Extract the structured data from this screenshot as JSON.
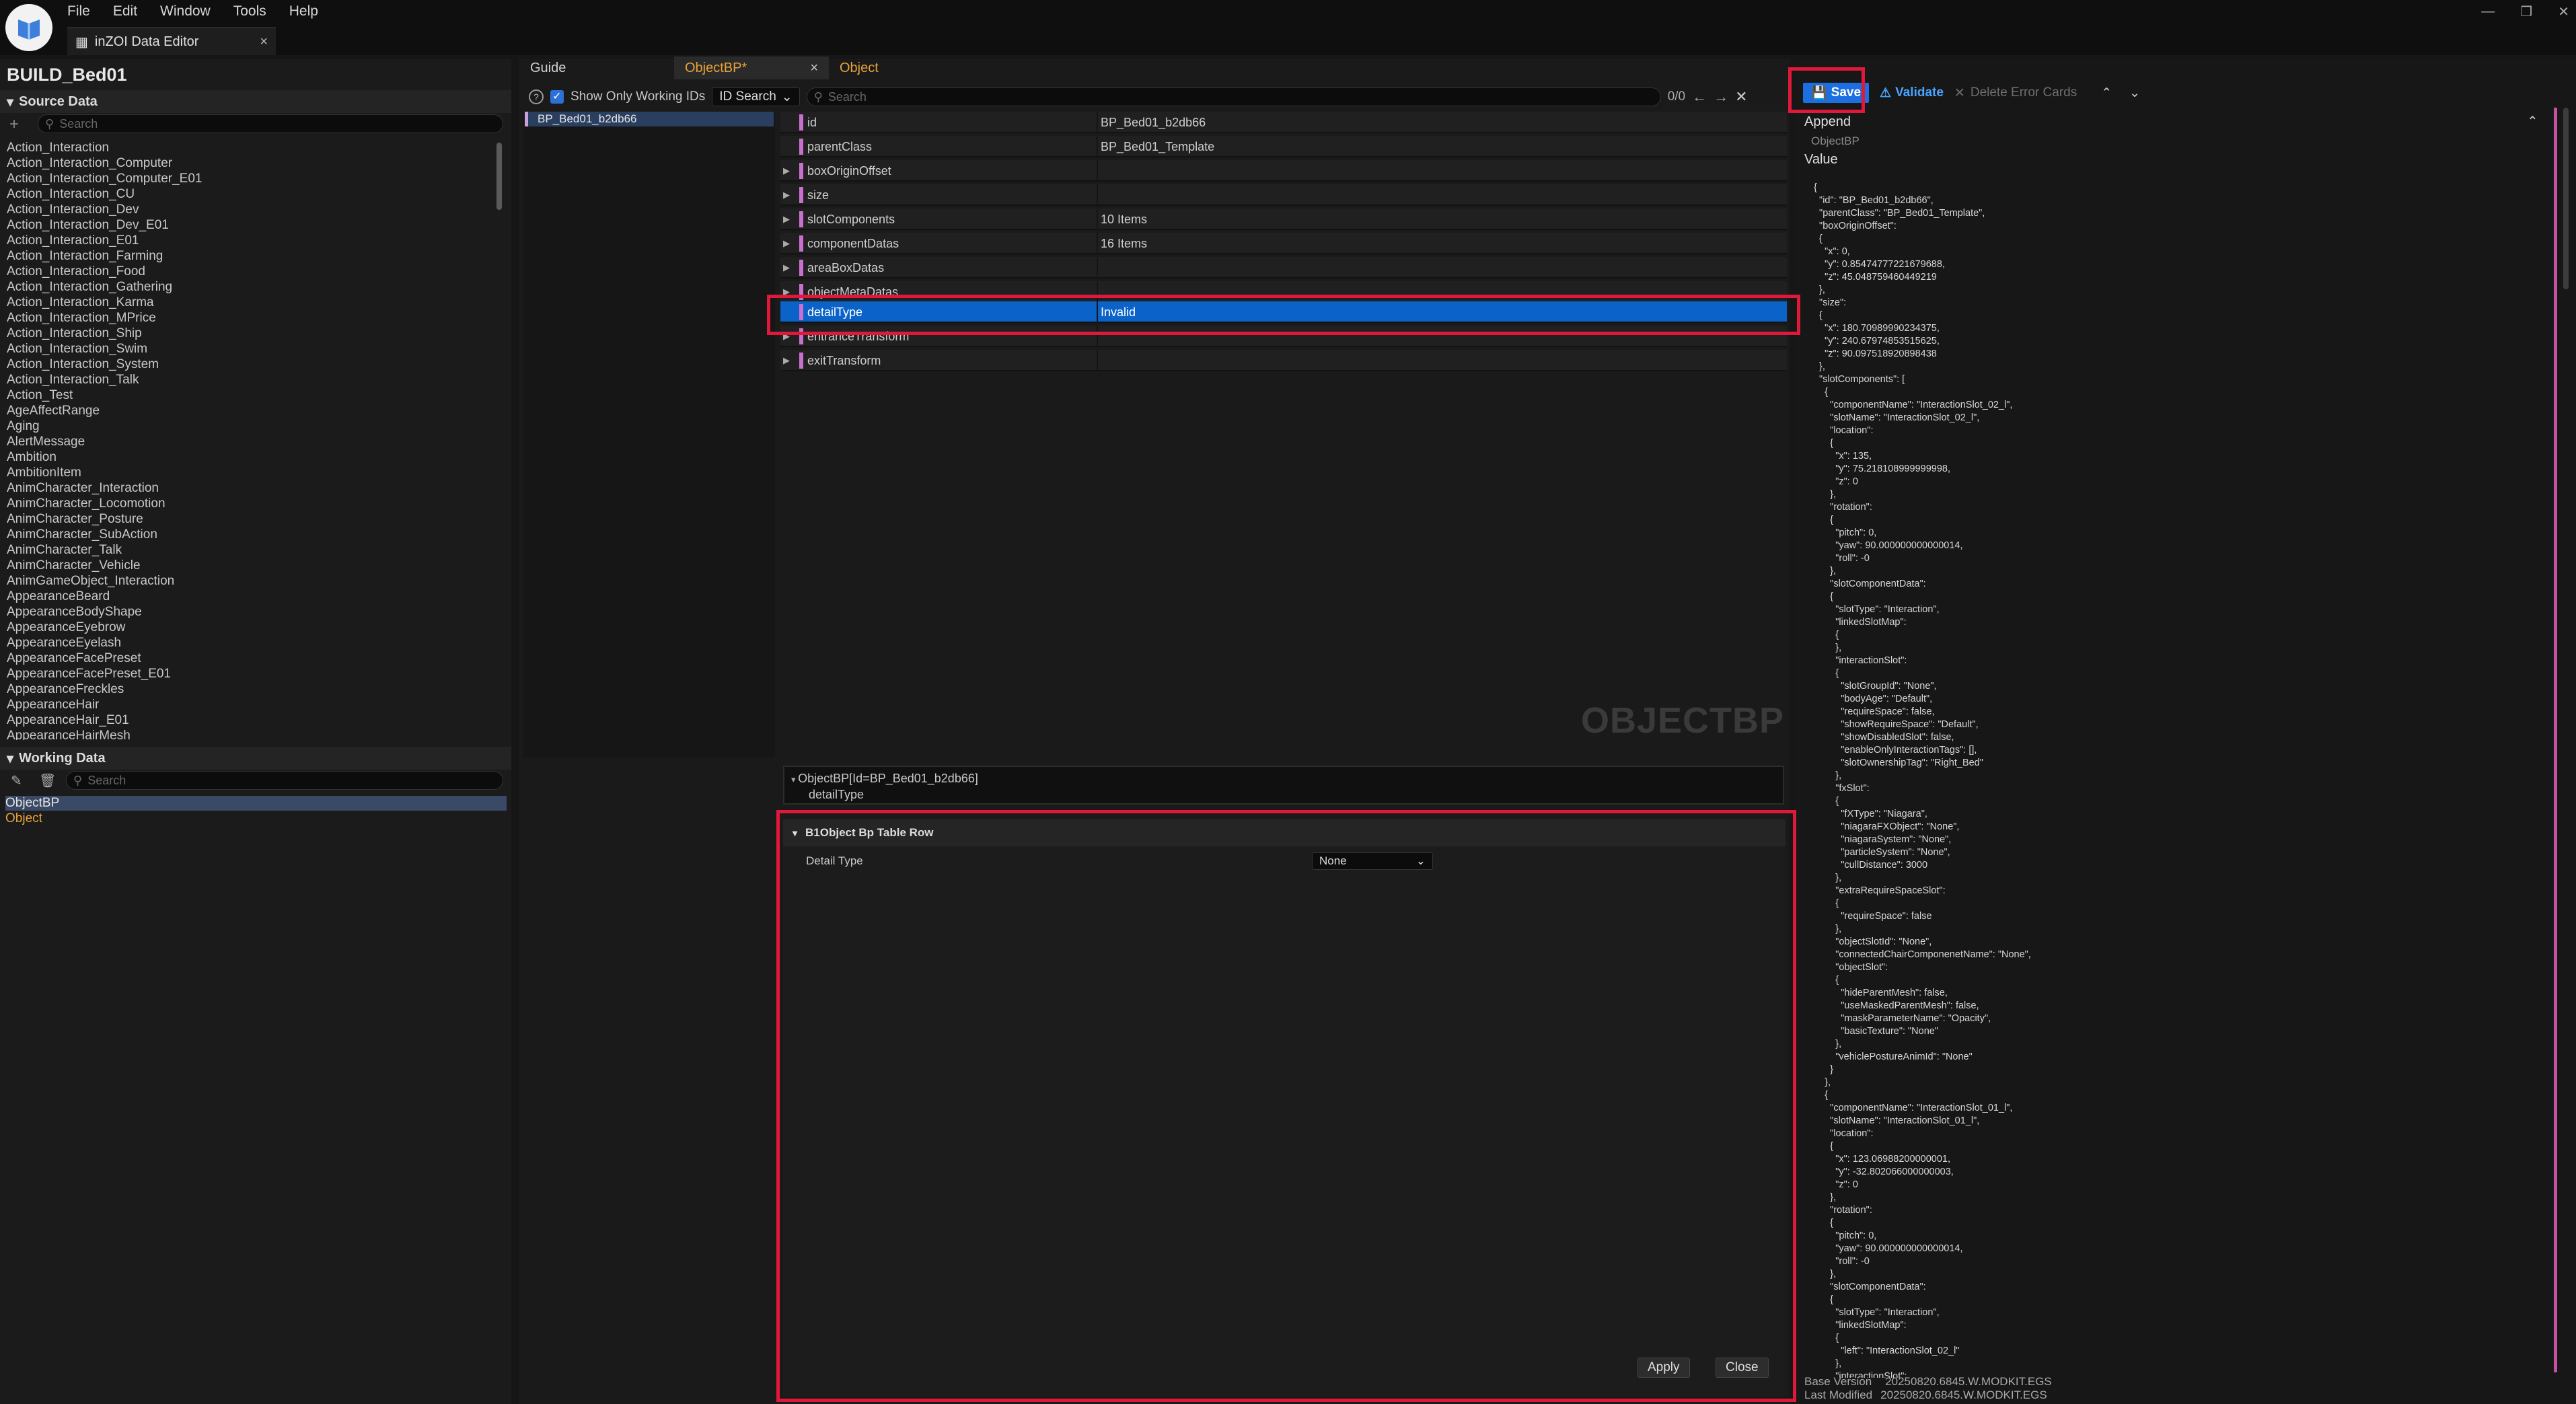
{
  "menu": {
    "file": "File",
    "edit": "Edit",
    "window": "Window",
    "tools": "Tools",
    "help": "Help"
  },
  "doc_tab": {
    "title": "inZOI Data Editor",
    "close": "×"
  },
  "left": {
    "title": "BUILD_Bed01",
    "source_header": "Source Data",
    "search_placeholder": "Search",
    "source_items": [
      "Action_Interaction",
      "Action_Interaction_Computer",
      "Action_Interaction_Computer_E01",
      "Action_Interaction_CU",
      "Action_Interaction_Dev",
      "Action_Interaction_Dev_E01",
      "Action_Interaction_E01",
      "Action_Interaction_Farming",
      "Action_Interaction_Food",
      "Action_Interaction_Gathering",
      "Action_Interaction_Karma",
      "Action_Interaction_MPrice",
      "Action_Interaction_Ship",
      "Action_Interaction_Swim",
      "Action_Interaction_System",
      "Action_Interaction_Talk",
      "Action_Test",
      "AgeAffectRange",
      "Aging",
      "AlertMessage",
      "Ambition",
      "AmbitionItem",
      "AnimCharacter_Interaction",
      "AnimCharacter_Locomotion",
      "AnimCharacter_Posture",
      "AnimCharacter_SubAction",
      "AnimCharacter_Talk",
      "AnimCharacter_Vehicle",
      "AnimGameObject_Interaction",
      "AppearanceBeard",
      "AppearanceBodyShape",
      "AppearanceEyebrow",
      "AppearanceEyelash",
      "AppearanceFacePreset",
      "AppearanceFacePreset_E01",
      "AppearanceFreckles",
      "AppearanceHair",
      "AppearanceHair_E01",
      "AppearanceHairMesh"
    ],
    "working_header": "Working Data",
    "working_items": [
      "ObjectBP",
      "Object"
    ]
  },
  "middle": {
    "tabs": [
      "Guide",
      "ObjectBP*",
      "Object"
    ],
    "tab_close": "×",
    "show_only_label": "Show Only Working IDs",
    "id_search": "ID Search",
    "search_placeholder": "Search",
    "match_count": "0/0",
    "selected_id": "BP_Bed01_b2db66",
    "properties": [
      {
        "key": "id",
        "value": "BP_Bed01_b2db66"
      },
      {
        "key": "parentClass",
        "value": "BP_Bed01_Template"
      },
      {
        "key": "boxOriginOffset",
        "value": ""
      },
      {
        "key": "size",
        "value": ""
      },
      {
        "key": "slotComponents",
        "value": "10 Items"
      },
      {
        "key": "componentDatas",
        "value": "16 Items"
      },
      {
        "key": "areaBoxDatas",
        "value": ""
      },
      {
        "key": "objectMetaDatas",
        "value": ""
      },
      {
        "key": "detailType",
        "value": "Invalid"
      },
      {
        "key": "entranceTransform",
        "value": ""
      },
      {
        "key": "exitTransform",
        "value": ""
      }
    ],
    "watermark": "OBJECTBP",
    "path_line1": "ObjectBP[Id=BP_Bed01_b2db66]",
    "path_line2": "detailType",
    "detail_header": "B1Object Bp Table Row",
    "detail_label": "Detail Type",
    "detail_value": "None",
    "apply": "Apply",
    "close": "Close"
  },
  "right": {
    "save": "Save",
    "validate": "Validate",
    "delete_errors": "Delete Error Cards",
    "append": "Append",
    "object_label": "ObjectBP",
    "value_label": "Value",
    "json_text": "{\n  \"id\": \"BP_Bed01_b2db66\",\n  \"parentClass\": \"BP_Bed01_Template\",\n  \"boxOriginOffset\":\n  {\n    \"x\": 0,\n    \"y\": 0.85474777221679688,\n    \"z\": 45.048759460449219\n  },\n  \"size\":\n  {\n    \"x\": 180.70989990234375,\n    \"y\": 240.67974853515625,\n    \"z\": 90.097518920898438\n  },\n  \"slotComponents\": [\n    {\n      \"componentName\": \"InteractionSlot_02_l\",\n      \"slotName\": \"InteractionSlot_02_l\",\n      \"location\":\n      {\n        \"x\": 135,\n        \"y\": 75.218108999999998,\n        \"z\": 0\n      },\n      \"rotation\":\n      {\n        \"pitch\": 0,\n        \"yaw\": 90.000000000000014,\n        \"roll\": -0\n      },\n      \"slotComponentData\":\n      {\n        \"slotType\": \"Interaction\",\n        \"linkedSlotMap\":\n        {\n        },\n        \"interactionSlot\":\n        {\n          \"slotGroupId\": \"None\",\n          \"bodyAge\": \"Default\",\n          \"requireSpace\": false,\n          \"showRequireSpace\": \"Default\",\n          \"showDisabledSlot\": false,\n          \"enableOnlyInteractionTags\": [],\n          \"slotOwnershipTag\": \"Right_Bed\"\n        },\n        \"fxSlot\":\n        {\n          \"fXType\": \"Niagara\",\n          \"niagaraFXObject\": \"None\",\n          \"niagaraSystem\": \"None\",\n          \"particleSystem\": \"None\",\n          \"cullDistance\": 3000\n        },\n        \"extraRequireSpaceSlot\":\n        {\n          \"requireSpace\": false\n        },\n        \"objectSlotId\": \"None\",\n        \"connectedChairComponenetName\": \"None\",\n        \"objectSlot\":\n        {\n          \"hideParentMesh\": false,\n          \"useMaskedParentMesh\": false,\n          \"maskParameterName\": \"Opacity\",\n          \"basicTexture\": \"None\"\n        },\n        \"vehiclePostureAnimId\": \"None\"\n      }\n    },\n    {\n      \"componentName\": \"InteractionSlot_01_l\",\n      \"slotName\": \"InteractionSlot_01_l\",\n      \"location\":\n      {\n        \"x\": 123.06988200000001,\n        \"y\": -32.802066000000003,\n        \"z\": 0\n      },\n      \"rotation\":\n      {\n        \"pitch\": 0,\n        \"yaw\": 90.000000000000014,\n        \"roll\": -0\n      },\n      \"slotComponentData\":\n      {\n        \"slotType\": \"Interaction\",\n        \"linkedSlotMap\":\n        {\n          \"left\": \"InteractionSlot_02_l\"\n        },\n        \"interactionSlot\":",
    "base_version_label": "Base Version",
    "base_version": "20250820.6845.W.MODKIT.EGS",
    "last_modified_label": "Last Modified",
    "last_modified": "20250820.6845.W.MODKIT.EGS"
  },
  "colors": {
    "accent": "#1c6fe0",
    "selection": "#0b63c9",
    "highlight": "#e0193a",
    "tab_active": "#e8a33a"
  }
}
